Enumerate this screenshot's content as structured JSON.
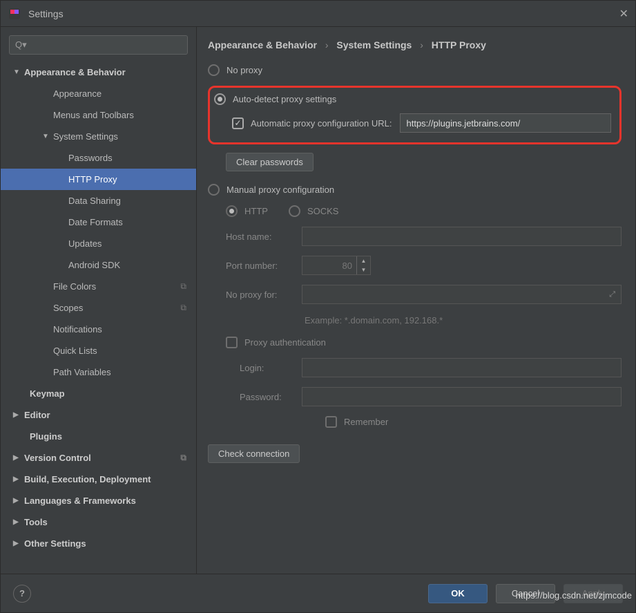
{
  "window": {
    "title": "Settings"
  },
  "search": {
    "placeholder": ""
  },
  "tree": [
    {
      "label": "Appearance & Behavior",
      "bold": true,
      "arrow": "down",
      "lvl": 0
    },
    {
      "label": "Appearance",
      "lvl": 2
    },
    {
      "label": "Menus and Toolbars",
      "lvl": 2
    },
    {
      "label": "System Settings",
      "arrow": "down",
      "lvl": 2
    },
    {
      "label": "Passwords",
      "lvl": 3
    },
    {
      "label": "HTTP Proxy",
      "lvl": 3,
      "selected": true
    },
    {
      "label": "Data Sharing",
      "lvl": 3
    },
    {
      "label": "Date Formats",
      "lvl": 3
    },
    {
      "label": "Updates",
      "lvl": 3
    },
    {
      "label": "Android SDK",
      "lvl": 3
    },
    {
      "label": "File Colors",
      "lvl": 2,
      "trail": true
    },
    {
      "label": "Scopes",
      "lvl": 2,
      "trail": true
    },
    {
      "label": "Notifications",
      "lvl": 2
    },
    {
      "label": "Quick Lists",
      "lvl": 2
    },
    {
      "label": "Path Variables",
      "lvl": 2
    },
    {
      "label": "Keymap",
      "bold": true,
      "lvl": 1
    },
    {
      "label": "Editor",
      "bold": true,
      "arrow": "right",
      "lvl": 0
    },
    {
      "label": "Plugins",
      "bold": true,
      "lvl": 1
    },
    {
      "label": "Version Control",
      "bold": true,
      "arrow": "right",
      "lvl": 0,
      "trail": true
    },
    {
      "label": "Build, Execution, Deployment",
      "bold": true,
      "arrow": "right",
      "lvl": 0
    },
    {
      "label": "Languages & Frameworks",
      "bold": true,
      "arrow": "right",
      "lvl": 0
    },
    {
      "label": "Tools",
      "bold": true,
      "arrow": "right",
      "lvl": 0
    },
    {
      "label": "Other Settings",
      "bold": true,
      "arrow": "right",
      "lvl": 0
    }
  ],
  "breadcrumb": [
    "Appearance & Behavior",
    "System Settings",
    "HTTP Proxy"
  ],
  "proxy": {
    "no_proxy": "No proxy",
    "auto_detect": "Auto-detect proxy settings",
    "auto_url_label": "Automatic proxy configuration URL:",
    "auto_url_value": "https://plugins.jetbrains.com/",
    "clear_passwords": "Clear passwords",
    "manual": "Manual proxy configuration",
    "http": "HTTP",
    "socks": "SOCKS",
    "host_label": "Host name:",
    "port_label": "Port number:",
    "port_value": "80",
    "noproxyfor_label": "No proxy for:",
    "example": "Example: *.domain.com, 192.168.*",
    "proxy_auth": "Proxy authentication",
    "login_label": "Login:",
    "password_label": "Password:",
    "remember": "Remember",
    "check_connection": "Check connection"
  },
  "footer": {
    "ok": "OK",
    "cancel": "Cancel",
    "apply": "Apply"
  },
  "watermark": "https://blog.csdn.net/zjmcode"
}
